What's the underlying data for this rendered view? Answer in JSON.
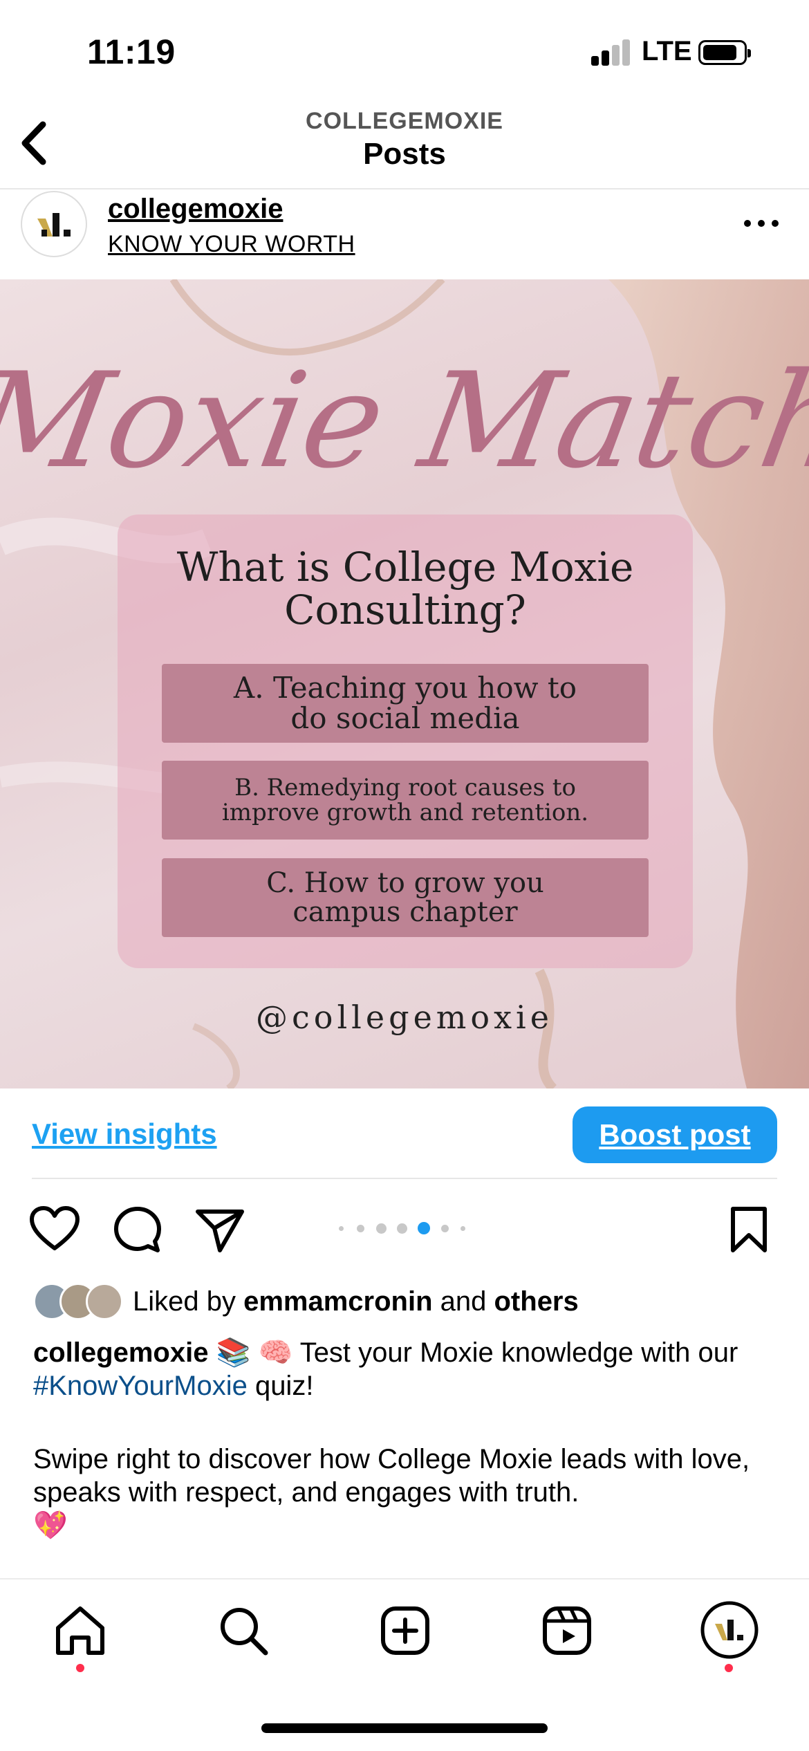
{
  "status_bar": {
    "time": "11:19",
    "network": "LTE"
  },
  "header": {
    "account": "COLLEGEMOXIE",
    "title": "Posts"
  },
  "post": {
    "username": "collegemoxie",
    "subtitle": "KNOW YOUR WORTH",
    "image": {
      "script_title": "Moxie Match",
      "question_line1": "What is College Moxie",
      "question_line2": "Consulting?",
      "options": [
        {
          "line1": "A. Teaching you how to",
          "line2": "do social media"
        },
        {
          "line1": "B. Remedying root causes to",
          "line2": "improve growth and retention."
        },
        {
          "line1": "C. How to grow you",
          "line2": "campus chapter"
        }
      ],
      "handle": "@collegemoxie"
    },
    "view_insights_label": "View insights",
    "boost_label": "Boost post",
    "carousel": {
      "count": 7,
      "active_index": 4
    },
    "likes": {
      "prefix": "Liked by ",
      "user": "emmamcronin",
      "middle": " and ",
      "others": "others"
    },
    "caption": {
      "username": "collegemoxie",
      "emojis": "📚 🧠",
      "text1": " Test your Moxie knowledge with our ",
      "hashtag": "#KnowYourMoxie",
      "text2": " quiz!",
      "paragraph2": "Swipe right to discover how College Moxie leads with love, speaks with respect, and engages with truth.",
      "emoji_end": "💖"
    }
  },
  "colors": {
    "link_blue": "#1da1f2",
    "boost_blue": "#1d9bf0",
    "script_pink": "#b56f86",
    "option_bg": "#bd8394",
    "hashtag": "#0b4f8a",
    "notification_red": "#ff2e4c"
  },
  "tab_bar": {
    "items": [
      "home-icon",
      "search-icon",
      "create-post-icon",
      "reels-icon",
      "profile-avatar"
    ]
  }
}
